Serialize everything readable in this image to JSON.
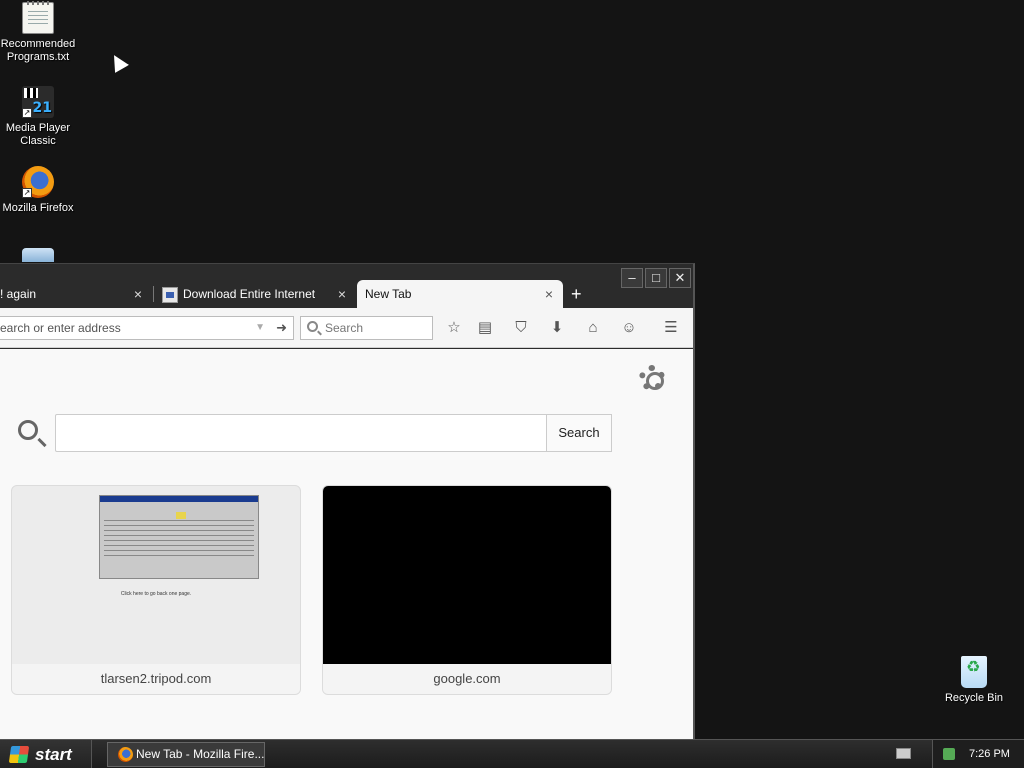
{
  "desktop": {
    "icons": [
      {
        "label": "Recommended Programs.txt",
        "icon": "notepad-icon"
      },
      {
        "label": "Media Player Classic",
        "icon": "mpc-icon",
        "badge": "21"
      },
      {
        "label": "Mozilla Firefox",
        "icon": "firefox-icon"
      },
      {
        "label": "",
        "icon": "partial-icon"
      }
    ],
    "recycle_bin": {
      "label": "Recycle Bin",
      "icon": "recycle-bin-icon"
    }
  },
  "browser": {
    "window_controls": {
      "minimize": "‒",
      "maximize": "□",
      "close": "✕"
    },
    "tabs": [
      {
        "label": "! again",
        "active": false
      },
      {
        "label": "Download Entire Internet",
        "active": false
      },
      {
        "label": "New Tab",
        "active": true
      }
    ],
    "new_tab_symbol": "+",
    "close_symbol": "×",
    "urlbar": {
      "placeholder": "earch or enter address"
    },
    "searchbar": {
      "placeholder": "Search"
    },
    "toolbar_icons": [
      "bookmark-star-icon",
      "reading-list-icon",
      "pocket-icon",
      "download-icon",
      "home-icon",
      "chat-icon",
      "menu-icon"
    ],
    "newtab": {
      "search_button": "Search",
      "tiles": [
        {
          "label": "tlarsen2.tripod.com",
          "thumb_text": "Click here to go back one page."
        },
        {
          "label": "google.com"
        }
      ]
    }
  },
  "taskbar": {
    "start_label": "start",
    "tasks": [
      {
        "label": "New Tab - Mozilla Fire..."
      }
    ],
    "clock": "7:26 PM"
  }
}
